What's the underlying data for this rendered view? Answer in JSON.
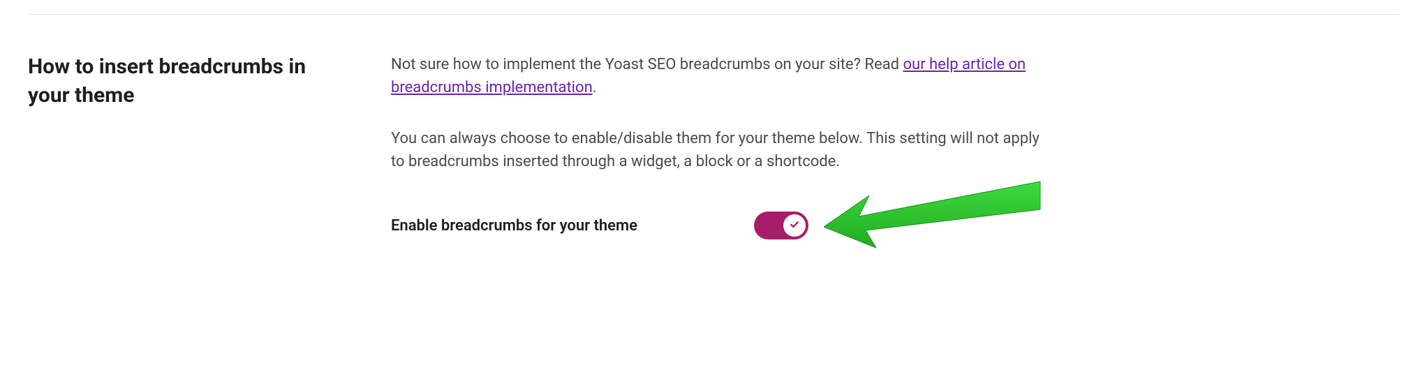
{
  "section": {
    "heading": "How to insert breadcrumbs in your theme",
    "paragraph1_prefix": "Not sure how to implement the Yoast SEO breadcrumbs on your site? Read ",
    "paragraph1_link": "our help article on breadcrumbs implementation",
    "paragraph1_suffix": ".",
    "paragraph2": "You can always choose to enable/disable them for your theme below. This setting will not apply to breadcrumbs inserted through a widget, a block or a shortcode."
  },
  "toggle": {
    "label": "Enable breadcrumbs for your theme",
    "enabled": true
  },
  "colors": {
    "accent": "#a61e69",
    "link": "#6b21a8",
    "annotation": "#22c122"
  }
}
